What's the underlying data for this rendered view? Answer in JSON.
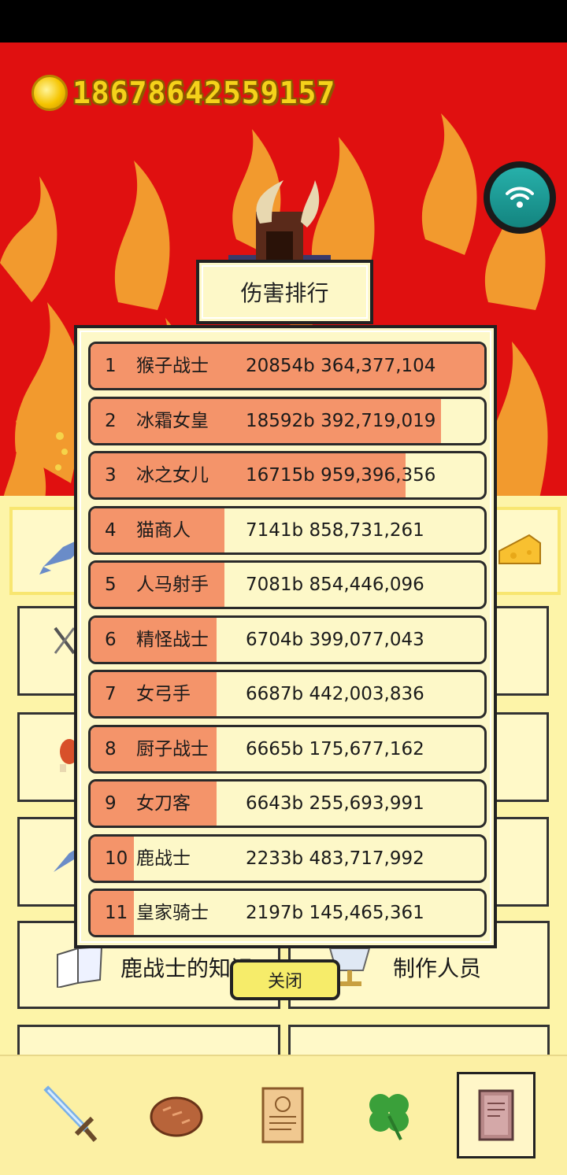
{
  "hud": {
    "coins": "18678642559157"
  },
  "dialog": {
    "title": "伤害排行",
    "close_label": "关闭",
    "rows": [
      {
        "rank": "1",
        "name": "猴子战士",
        "damage": "20854b 364,377,104",
        "fill": 1.0
      },
      {
        "rank": "2",
        "name": "冰霜女皇",
        "damage": "18592b 392,719,019",
        "fill": 0.89
      },
      {
        "rank": "3",
        "name": "冰之女儿",
        "damage": "16715b 959,396,356",
        "fill": 0.8
      },
      {
        "rank": "4",
        "name": "猫商人",
        "damage": "7141b 858,731,261",
        "fill": 0.34
      },
      {
        "rank": "5",
        "name": "人马射手",
        "damage": "7081b 854,446,096",
        "fill": 0.34
      },
      {
        "rank": "6",
        "name": "精怪战士",
        "damage": "6704b 399,077,043",
        "fill": 0.32
      },
      {
        "rank": "7",
        "name": "女弓手",
        "damage": "6687b 442,003,836",
        "fill": 0.32
      },
      {
        "rank": "8",
        "name": "厨子战士",
        "damage": "6665b 175,677,162",
        "fill": 0.32
      },
      {
        "rank": "9",
        "name": "女刀客",
        "damage": "6643b 255,693,991",
        "fill": 0.32
      },
      {
        "rank": "10",
        "name": "鹿战士",
        "damage": "2233b 483,717,992",
        "fill": 0.11
      },
      {
        "rank": "11",
        "name": "皇家骑士",
        "damage": "2197b 145,465,361",
        "fill": 0.11
      }
    ]
  },
  "menu": {
    "knowledge_label": "鹿战士的知识",
    "credits_label": "制作人员"
  },
  "nav": {
    "items": [
      {
        "icon": "sword-icon",
        "active": false
      },
      {
        "icon": "bread-icon",
        "active": false
      },
      {
        "icon": "scroll-icon",
        "active": false
      },
      {
        "icon": "clover-icon",
        "active": false
      },
      {
        "icon": "book-icon",
        "active": true
      }
    ]
  },
  "colors": {
    "background_red": "#e01010",
    "coin_text": "#f5d21a",
    "bar_fill": "#f4946a",
    "panel": "#fdf8c8",
    "close_button": "#f6ec6a",
    "wifi_button": "#1b9d97"
  }
}
